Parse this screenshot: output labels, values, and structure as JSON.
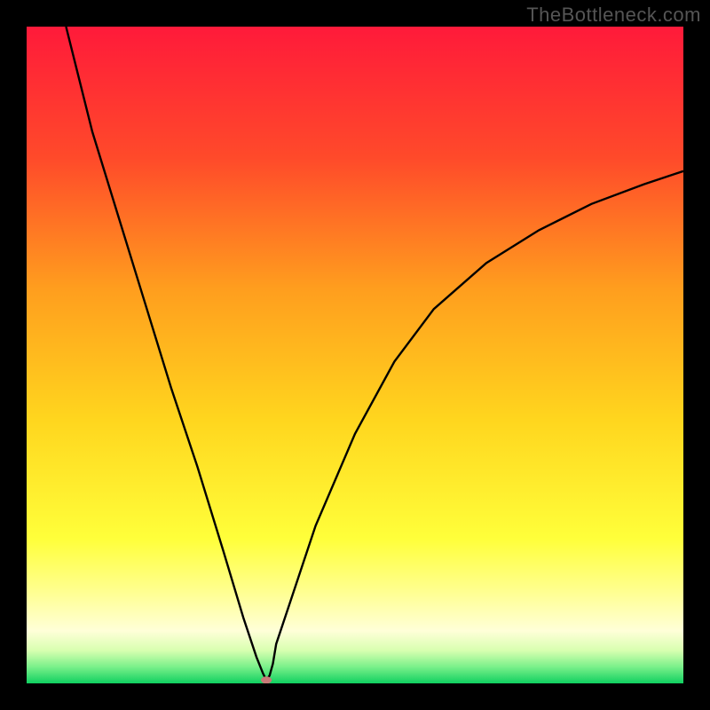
{
  "watermark": "TheBottleneck.com",
  "chart_data": {
    "type": "line",
    "title": "",
    "xlabel": "",
    "ylabel": "",
    "xlim": [
      0,
      100
    ],
    "ylim": [
      0,
      100
    ],
    "gradient_stops": [
      {
        "offset": 0.0,
        "color": "#ff1a3a"
      },
      {
        "offset": 0.2,
        "color": "#ff4a2a"
      },
      {
        "offset": 0.4,
        "color": "#ff9e1e"
      },
      {
        "offset": 0.6,
        "color": "#ffd61e"
      },
      {
        "offset": 0.78,
        "color": "#ffff3a"
      },
      {
        "offset": 0.86,
        "color": "#ffff90"
      },
      {
        "offset": 0.92,
        "color": "#ffffd8"
      },
      {
        "offset": 0.95,
        "color": "#d8ffb0"
      },
      {
        "offset": 0.975,
        "color": "#7af08a"
      },
      {
        "offset": 1.0,
        "color": "#10d060"
      }
    ],
    "green_band": {
      "y_from": 96,
      "y_to": 100,
      "color_top": "#ffffc0",
      "color_bottom": "#2be070"
    },
    "series": [
      {
        "name": "bottleneck-curve",
        "x": [
          6,
          8,
          10,
          14,
          18,
          22,
          26,
          30,
          33,
          35,
          36,
          36.5,
          37,
          37.5,
          38,
          40,
          44,
          50,
          56,
          62,
          70,
          78,
          86,
          94,
          100
        ],
        "y": [
          100,
          92,
          84,
          71,
          58,
          45,
          33,
          20,
          10,
          4,
          1.5,
          0.5,
          1.2,
          3,
          6,
          12,
          24,
          38,
          49,
          57,
          64,
          69,
          73,
          76,
          78
        ]
      }
    ],
    "marker": {
      "x": 36.5,
      "y": 0.5,
      "rx": 6,
      "ry": 4,
      "color": "#c97a78"
    }
  }
}
